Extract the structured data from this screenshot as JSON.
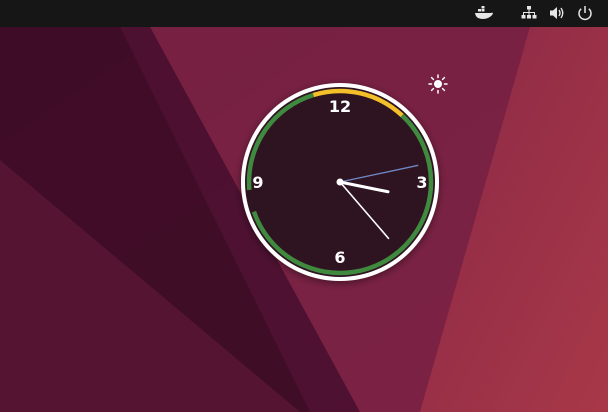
{
  "topbar": {
    "icons": [
      "docker-whale-icon",
      "network-icon",
      "volume-icon",
      "power-icon"
    ]
  },
  "clock": {
    "numerals": [
      "12",
      "3",
      "6",
      "9"
    ],
    "time": {
      "hours": 3,
      "minutes": 23,
      "seconds": 13
    },
    "colors": {
      "face": "#2e1420",
      "rim": "#ffffff",
      "green_arc": "#3f8a3f",
      "yellow_arc": "#f4c02a",
      "hour_hand": "#ffffff",
      "minute_hand": "#ffffff",
      "second_hand": "#6e86c4"
    }
  },
  "weather": {
    "icon": "sun-icon"
  },
  "colors": {
    "topbar": "#161616",
    "wallpaper_base": "#6e1f43",
    "wallpaper_dark": "#3a0d22",
    "wallpaper_right": "#9c2f47"
  }
}
